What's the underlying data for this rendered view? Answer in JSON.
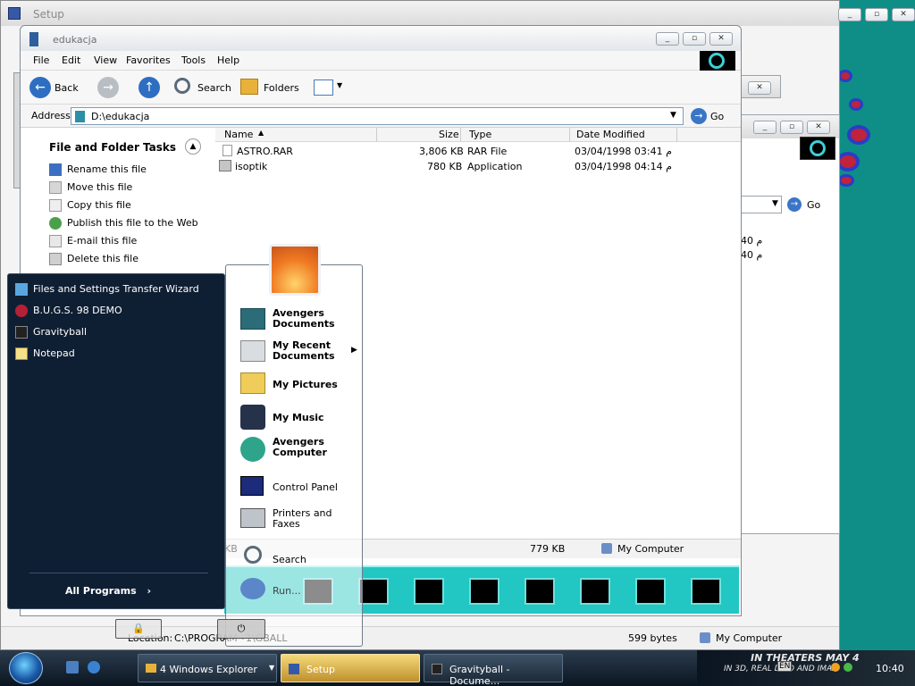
{
  "setup_window": {
    "title": "Setup",
    "location_label": "Location:",
    "location_value": "C:\\PROGRAM~1\\GBALL",
    "status_size": "599 bytes",
    "status_zone": "My Computer"
  },
  "back_window": {
    "go_label": "Go",
    "list_dates": [
      "م 40",
      "م 40"
    ]
  },
  "explorer": {
    "title": "edukacja",
    "menu": [
      "File",
      "Edit",
      "View",
      "Favorites",
      "Tools",
      "Help"
    ],
    "toolbar": {
      "back": "Back",
      "search": "Search",
      "folders": "Folders"
    },
    "address_label": "Address",
    "address_value": "D:\\edukacja",
    "go_label": "Go",
    "tasks_title": "File and Folder Tasks",
    "tasks": [
      {
        "label": "Rename this file",
        "icon": "rename-icon"
      },
      {
        "label": "Move this file",
        "icon": "move-icon"
      },
      {
        "label": "Copy this file",
        "icon": "copy-icon"
      },
      {
        "label": "Publish this file to the Web",
        "icon": "publish-web-icon"
      },
      {
        "label": "E-mail this file",
        "icon": "email-icon"
      },
      {
        "label": "Delete this file",
        "icon": "delete-icon"
      }
    ],
    "columns": [
      "Name",
      "Size",
      "Type",
      "Date Modified"
    ],
    "files": [
      {
        "name": "ASTRO.RAR",
        "size": "3,806 KB",
        "type": "RAR File",
        "date": "03/04/1998 03:41 م"
      },
      {
        "name": "isoptik",
        "size": "780 KB",
        "type": "Application",
        "date": "03/04/1998 04:14 م"
      }
    ],
    "status_left": "KB",
    "status_size": "779 KB",
    "status_zone": "My Computer"
  },
  "start_menu": {
    "pinned": [
      {
        "label": "Files and Settings Transfer Wizard",
        "icon": "transfer-wizard-icon"
      },
      {
        "label": "B.U.G.S. 98 DEMO",
        "icon": "bug-icon"
      },
      {
        "label": "Gravityball",
        "icon": "gravityball-icon"
      },
      {
        "label": "Notepad",
        "icon": "notepad-icon"
      }
    ],
    "all_programs": "All Programs",
    "right": {
      "docs": "Avengers Documents",
      "recent": "My Recent Documents",
      "pictures": "My Pictures",
      "music": "My Music",
      "computer": "Avengers Computer",
      "control_panel": "Control Panel",
      "printers": "Printers and Faxes",
      "search": "Search",
      "run": "Run..."
    }
  },
  "taskbar": {
    "buttons": [
      "4 Windows Explorer",
      "Setup",
      "Gravityball - Docume..."
    ],
    "tray_banner": "IN THEATERS MAY 4",
    "tray_banner2": "IN 3D, REAL D 3D AND IMAX",
    "lang": "EN",
    "clock": "10:40"
  },
  "colors": {
    "desktop": "#0e8e86",
    "start_left": "#0f1f33",
    "taskbar": "#0b1521"
  }
}
